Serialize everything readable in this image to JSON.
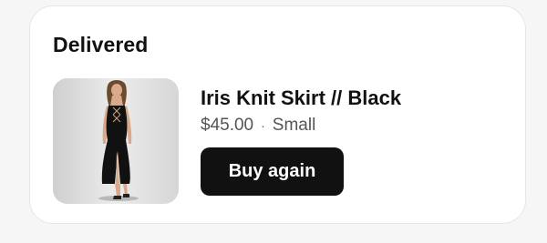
{
  "order": {
    "status": "Delivered",
    "item": {
      "name": "Iris Knit Skirt // Black",
      "price": "$45.00",
      "separator": "·",
      "size": "Small",
      "image_icon": "product-photo"
    },
    "buy_again_label": "Buy again"
  },
  "colors": {
    "button_bg": "#111111",
    "button_text": "#ffffff",
    "card_bg": "#ffffff",
    "page_bg": "#f6f6f6",
    "meta_text": "#555555"
  }
}
